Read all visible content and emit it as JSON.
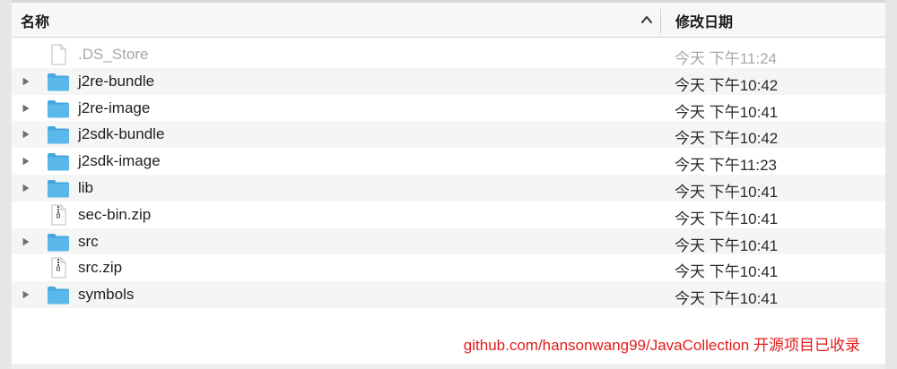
{
  "header": {
    "name_label": "名称",
    "date_label": "修改日期",
    "sort_icon": "chevron-up-icon"
  },
  "files": [
    {
      "name": ".DS_Store",
      "date": "今天 下午11:24",
      "type": "file",
      "dim": true
    },
    {
      "name": "j2re-bundle",
      "date": "今天 下午10:42",
      "type": "folder"
    },
    {
      "name": "j2re-image",
      "date": "今天 下午10:41",
      "type": "folder"
    },
    {
      "name": "j2sdk-bundle",
      "date": "今天 下午10:42",
      "type": "folder"
    },
    {
      "name": "j2sdk-image",
      "date": "今天 下午11:23",
      "type": "folder"
    },
    {
      "name": "lib",
      "date": "今天 下午10:41",
      "type": "folder"
    },
    {
      "name": "sec-bin.zip",
      "date": "今天 下午10:41",
      "type": "zip"
    },
    {
      "name": "src",
      "date": "今天 下午10:41",
      "type": "folder"
    },
    {
      "name": "src.zip",
      "date": "今天 下午10:41",
      "type": "zip"
    },
    {
      "name": "symbols",
      "date": "今天 下午10:41",
      "type": "folder"
    }
  ],
  "watermark": "github.com/hansonwang99/JavaCollection 开源项目已收录",
  "colors": {
    "folder": "#5ab9ea",
    "folder_tab": "#46a8df",
    "watermark": "#e41c1c",
    "alt_row": "#f4f5f5"
  }
}
